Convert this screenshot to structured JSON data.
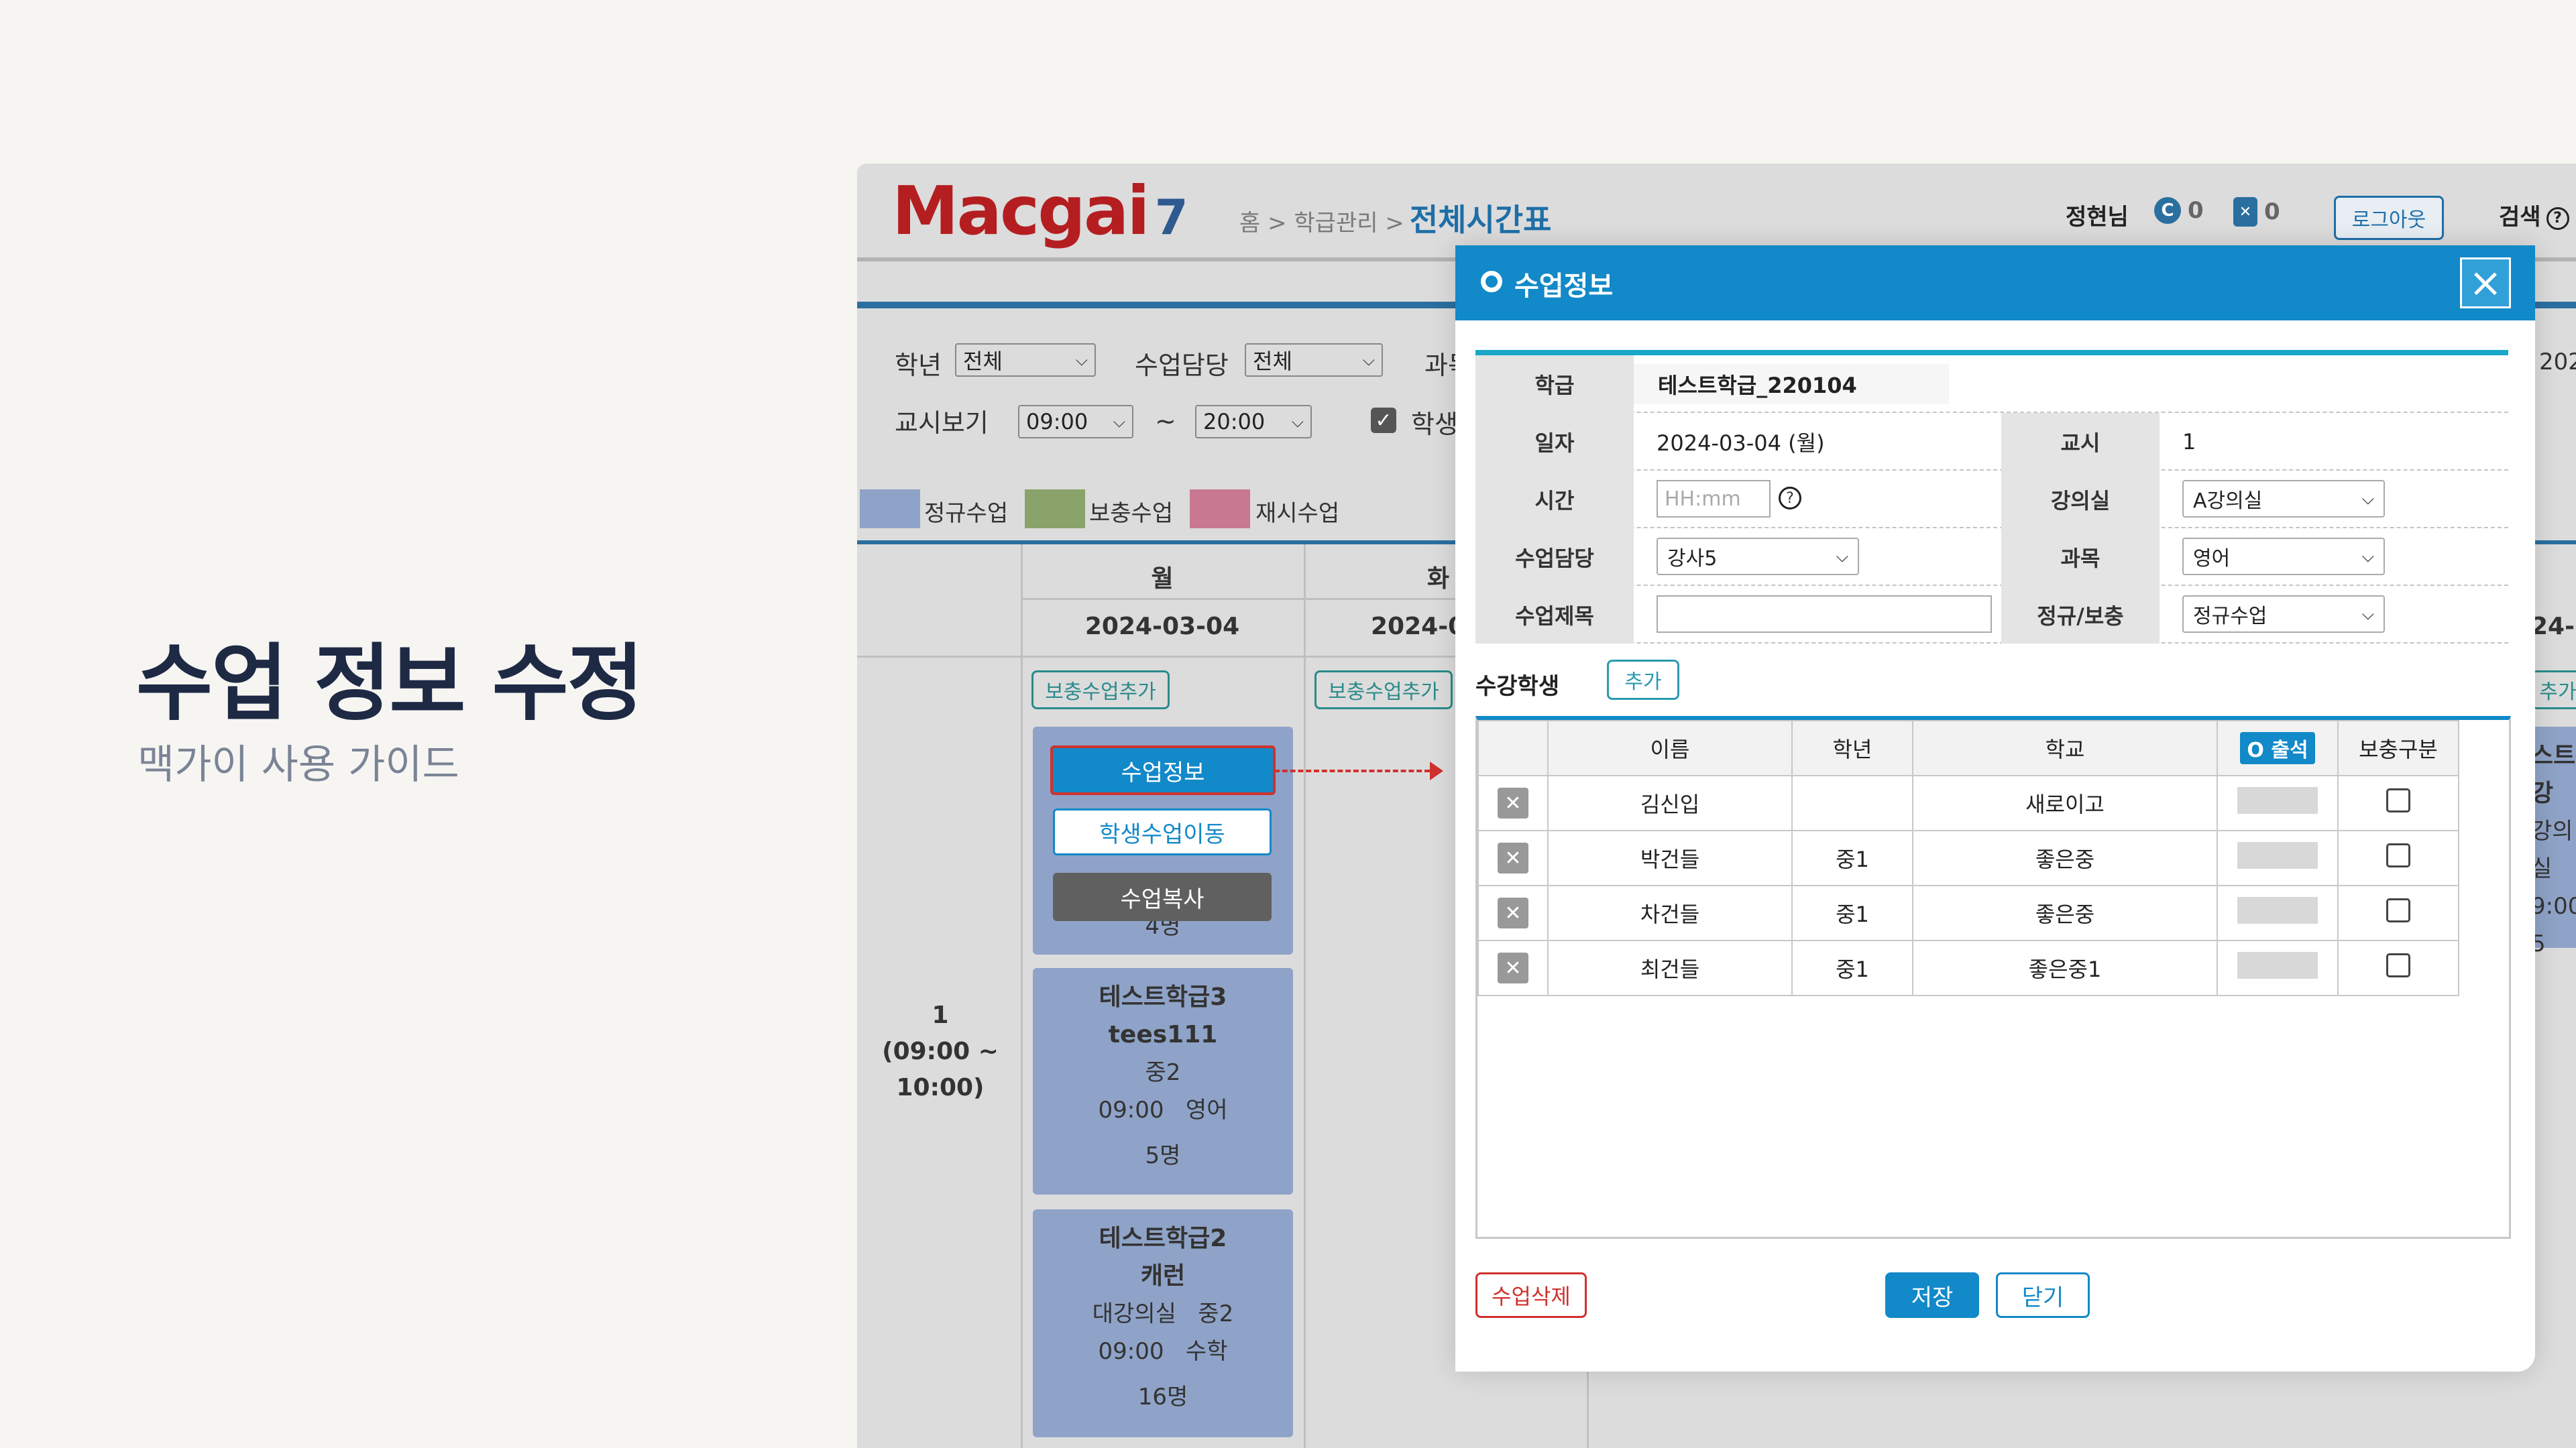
{
  "guide": {
    "title": "수업 정보 수정",
    "subtitle": "맥가이 사용 가이드"
  },
  "header": {
    "logo": "Macgai",
    "logo_num": "7",
    "breadcrumb": "홈 > 학급관리 >",
    "current_page": "전체시간표",
    "user": "정현님",
    "count1": "0",
    "count2": "0",
    "logout": "로그아웃",
    "search": "검색"
  },
  "filters": {
    "grade_label": "학년",
    "grade_value": "전체",
    "teacher_label": "수업담당",
    "teacher_value": "전체",
    "subject_label_partial": "과목",
    "period_label": "교시보기",
    "from": "09:00",
    "tilde": "~",
    "to": "20:00",
    "student_label_partial": "학생"
  },
  "legend": [
    {
      "label": "정규수업",
      "color": "#8fa3c8"
    },
    {
      "label": "보충수업",
      "color": "#8aa36a"
    },
    {
      "label": "재시수업",
      "color": "#c87890"
    }
  ],
  "schedule": {
    "day_mon": "월",
    "date_mon": "2024-03-04",
    "day_tue_partial": "화",
    "date_tue_partial": "2024-0",
    "right_date_partial": "202",
    "right_date2_partial": "24-",
    "add_label": "보충수업추가",
    "add_label_partial": "추가",
    "period": {
      "num": "1",
      "range_top": "(09:00 ~",
      "range_bot": "10:00)"
    },
    "card1": {
      "line_partial": "4명"
    },
    "context_menu": {
      "info": "수업정보",
      "move": "학생수업이동",
      "copy": "수업복사"
    },
    "card2": {
      "title": "테스트학급3",
      "teacher": "tees111",
      "grade": "중2",
      "time_subject": "09:00   영어",
      "count": "5명"
    },
    "card3": {
      "title": "테스트학급2",
      "teacher": "캐런",
      "room_grade": "대강의실   중2",
      "time_subject": "09:00   수학",
      "count": "16명"
    },
    "right_card": {
      "l1": "스트",
      "l2": "강",
      "l3": "강의실",
      "l4": "9:00",
      "l5": "5"
    }
  },
  "modal": {
    "title": "수업정보",
    "close_icon": "×",
    "class_label": "학급",
    "class_value": "테스트학급_220104",
    "date_label": "일자",
    "date_value": "2024-03-04 (월)",
    "period_label": "교시",
    "period_value": "1",
    "time_label": "시간",
    "time_placeholder": "HH:mm",
    "room_label": "강의실",
    "room_value": "A강의실",
    "teacher_label": "수업담당",
    "teacher_value": "강사5",
    "subject_label": "과목",
    "subject_value": "영어",
    "title_label": "수업제목",
    "title_value": "",
    "type_label": "정규/보충",
    "type_value": "정규수업",
    "students_label": "수강학생",
    "students_add": "추가",
    "columns": {
      "name": "이름",
      "grade": "학년",
      "school": "학교",
      "attendance": "O 출석",
      "supplement": "보충구분"
    },
    "students": [
      {
        "name": "김신입",
        "grade": "",
        "school": "새로이고"
      },
      {
        "name": "박건들",
        "grade": "중1",
        "school": "좋은중"
      },
      {
        "name": "차건들",
        "grade": "중1",
        "school": "좋은중"
      },
      {
        "name": "최건들",
        "grade": "중1",
        "school": "좋은중1"
      }
    ],
    "delete_btn": "수업삭제",
    "save_btn": "저장",
    "close_btn": "닫기"
  }
}
